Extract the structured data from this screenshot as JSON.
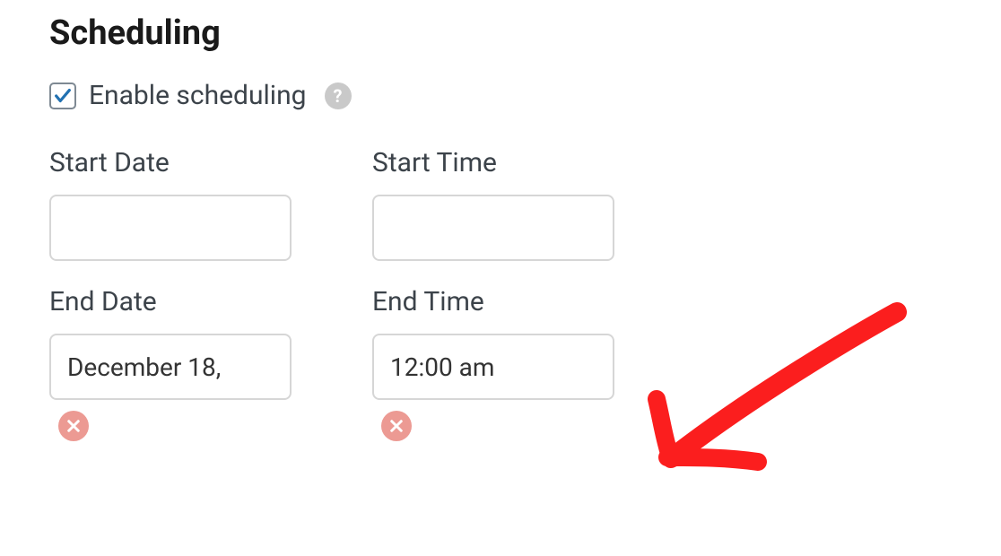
{
  "heading": "Scheduling",
  "enable": {
    "label": "Enable scheduling",
    "checked": true
  },
  "fields": {
    "start_date": {
      "label": "Start Date",
      "value": ""
    },
    "start_time": {
      "label": "Start Time",
      "value": ""
    },
    "end_date": {
      "label": "End Date",
      "value": "December 18,"
    },
    "end_time": {
      "label": "End Time",
      "value": "12:00 am"
    }
  },
  "annotations": {
    "arrow_color": "#fb1e1e"
  }
}
